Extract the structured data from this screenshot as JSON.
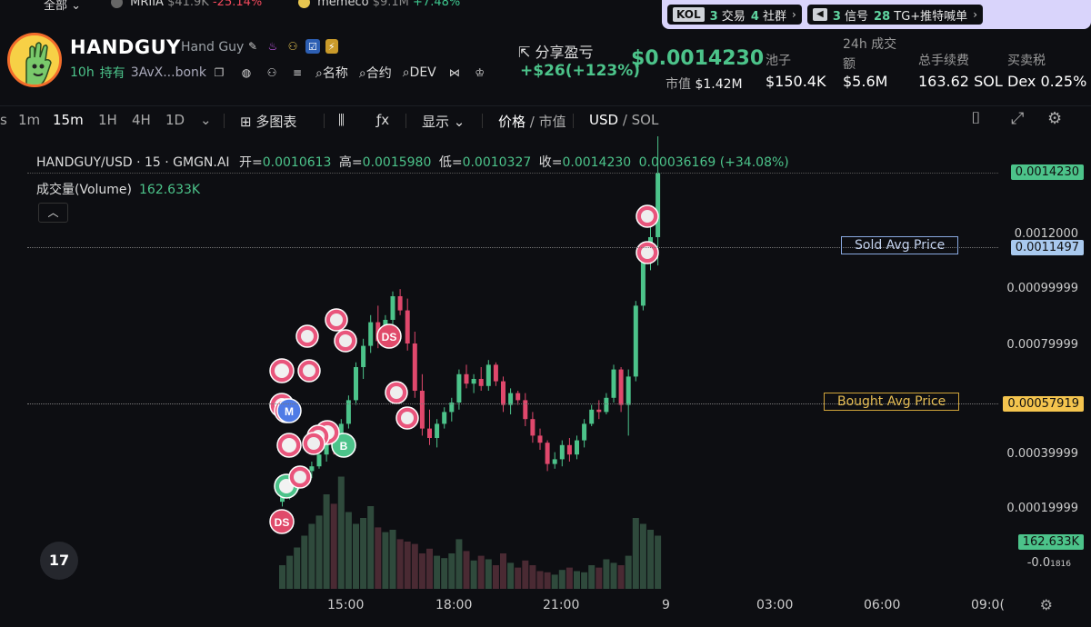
{
  "ticker": {
    "all_label": "全部",
    "items": [
      {
        "symbol": "MRIIA",
        "value": "$41.9K",
        "change": "-25.14%"
      },
      {
        "symbol": "memeco",
        "value": "$9.1M",
        "change": "+7.48%"
      }
    ]
  },
  "kol_panel": {
    "kol_badge": "KOL",
    "kol_trades_num": "3",
    "kol_trades_label": "交易",
    "kol_social_num": "4",
    "kol_social_label": "社群",
    "signal_num": "3",
    "signal_label": "信号",
    "tg_num": "28",
    "tg_label": "TG+推特喊单"
  },
  "token": {
    "name": "HANDGUY",
    "full_name": "Hand Guy",
    "age": "10h",
    "hold_label": "持有",
    "address": "3AvX...bonk",
    "links": {
      "name": "名称",
      "contract": "合约",
      "dev": "DEV"
    },
    "share_label": "分享盈亏",
    "pnl": "+$26(+123%)",
    "price": "$0.0014230",
    "mcap_label": "市值",
    "mcap": "$1.42M",
    "stats": [
      {
        "label": "池子",
        "value": "$150.4K"
      },
      {
        "label": "24h 成交额",
        "value": "$5.6M"
      },
      {
        "label": "总手续费",
        "value": "163.62 SOL"
      },
      {
        "label": "买卖税",
        "value": "Dex 0.25%"
      }
    ]
  },
  "toolbar": {
    "intervals": [
      "s",
      "1m",
      "15m",
      "1H",
      "4H",
      "1D"
    ],
    "active_interval": "15m",
    "multi_chart": "多图表",
    "display": "显示",
    "price_label": "价格",
    "mcap_label": "市值",
    "usd_label": "USD",
    "sol_label": "SOL"
  },
  "chart": {
    "pair": "HANDGUY/USD · 15 · GMGN.AI",
    "open_label": "开=",
    "open": "0.0010613",
    "high_label": "高=",
    "high": "0.0015980",
    "low_label": "低=",
    "low": "0.0010327",
    "close_label": "收=",
    "close": "0.0014230",
    "change": "0.00036169 (+34.08%)",
    "volume_label": "成交量(Volume)",
    "volume": "162.633K",
    "collapse_icon": "chevron-up-icon",
    "y_labels": [
      "0.0012000",
      "0.00099999",
      "0.00079999",
      "0.00039999",
      "0.00019999",
      "-0.0"
    ],
    "neg_small": "1816",
    "price_tag": "0.0014230",
    "sold_tag": "0.0011497",
    "bought_tag": "0.00057919",
    "volume_tag": "162.633K",
    "sold_label": "Sold Avg Price",
    "bought_label": "Bought Avg Price",
    "x_labels": [
      "15:00",
      "18:00",
      "21:00",
      "9",
      "03:00",
      "06:00",
      "09:0("
    ],
    "tv_logo": "17",
    "up_color": "#4cc38a",
    "down_color": "#e0486c"
  },
  "chart_data": {
    "type": "bar",
    "title": "",
    "xlabel": "",
    "ylabel": "",
    "ylim": [
      0,
      0.0016
    ],
    "candles": [
      {
        "o": 3e-05,
        "h": 6e-05,
        "l": 1e-05,
        "c": 5e-05
      },
      {
        "o": 5e-05,
        "h": 9e-05,
        "l": 4e-05,
        "c": 8e-05
      },
      {
        "o": 8e-05,
        "h": 0.00012,
        "l": 7e-05,
        "c": 0.00011
      },
      {
        "o": 0.00011,
        "h": 0.00018,
        "l": 0.0001,
        "c": 0.00016
      },
      {
        "o": 0.00016,
        "h": 0.0002,
        "l": 0.00013,
        "c": 0.00018
      },
      {
        "o": 0.00018,
        "h": 0.00025,
        "l": 0.00017,
        "c": 0.00023
      },
      {
        "o": 0.00023,
        "h": 0.0003,
        "l": 0.0002,
        "c": 0.00028
      },
      {
        "o": 0.00028,
        "h": 0.00033,
        "l": 0.00023,
        "c": 0.00026
      },
      {
        "o": 0.00026,
        "h": 0.00038,
        "l": 0.00024,
        "c": 0.00036
      },
      {
        "o": 0.00036,
        "h": 0.00048,
        "l": 0.00034,
        "c": 0.00046
      },
      {
        "o": 0.00046,
        "h": 0.00062,
        "l": 0.00044,
        "c": 0.0006
      },
      {
        "o": 0.0006,
        "h": 0.00072,
        "l": 0.00055,
        "c": 0.00069
      },
      {
        "o": 0.00069,
        "h": 0.00082,
        "l": 0.00066,
        "c": 0.00079
      },
      {
        "o": 0.00079,
        "h": 0.00086,
        "l": 0.00068,
        "c": 0.00071
      },
      {
        "o": 0.00071,
        "h": 0.00082,
        "l": 0.00069,
        "c": 0.0008
      },
      {
        "o": 0.0008,
        "h": 0.00092,
        "l": 0.00077,
        "c": 0.0009
      },
      {
        "o": 0.0009,
        "h": 0.00093,
        "l": 0.00082,
        "c": 0.00084
      },
      {
        "o": 0.00084,
        "h": 0.00089,
        "l": 0.00067,
        "c": 0.0007
      },
      {
        "o": 0.0007,
        "h": 0.00075,
        "l": 0.00047,
        "c": 0.0005
      },
      {
        "o": 0.0005,
        "h": 0.00057,
        "l": 0.00031,
        "c": 0.00034
      },
      {
        "o": 0.00034,
        "h": 0.00042,
        "l": 0.00027,
        "c": 0.0003
      },
      {
        "o": 0.0003,
        "h": 0.00038,
        "l": 0.00026,
        "c": 0.00036
      },
      {
        "o": 0.00036,
        "h": 0.00043,
        "l": 0.00034,
        "c": 0.00041
      },
      {
        "o": 0.00041,
        "h": 0.00047,
        "l": 0.00037,
        "c": 0.00045
      },
      {
        "o": 0.00045,
        "h": 0.00059,
        "l": 0.00042,
        "c": 0.00057
      },
      {
        "o": 0.00057,
        "h": 0.00061,
        "l": 0.00051,
        "c": 0.00053
      },
      {
        "o": 0.00053,
        "h": 0.00057,
        "l": 0.00049,
        "c": 0.00055
      },
      {
        "o": 0.00055,
        "h": 0.0006,
        "l": 0.0005,
        "c": 0.00052
      },
      {
        "o": 0.00052,
        "h": 0.00063,
        "l": 0.0005,
        "c": 0.00061
      },
      {
        "o": 0.00061,
        "h": 0.00062,
        "l": 0.00052,
        "c": 0.00054
      },
      {
        "o": 0.00054,
        "h": 0.00056,
        "l": 0.00041,
        "c": 0.00044
      },
      {
        "o": 0.00044,
        "h": 0.00051,
        "l": 0.0004,
        "c": 0.00049
      },
      {
        "o": 0.00049,
        "h": 0.0005,
        "l": 0.00044,
        "c": 0.00046
      },
      {
        "o": 0.00046,
        "h": 0.00049,
        "l": 0.00035,
        "c": 0.00038
      },
      {
        "o": 0.00038,
        "h": 0.00041,
        "l": 0.00028,
        "c": 0.00031
      },
      {
        "o": 0.00031,
        "h": 0.00034,
        "l": 0.00025,
        "c": 0.00028
      },
      {
        "o": 0.00028,
        "h": 0.00029,
        "l": 0.00016,
        "c": 0.00019
      },
      {
        "o": 0.00019,
        "h": 0.00024,
        "l": 0.00017,
        "c": 0.00021
      },
      {
        "o": 0.00021,
        "h": 0.00029,
        "l": 0.00018,
        "c": 0.00027
      },
      {
        "o": 0.00027,
        "h": 0.0003,
        "l": 0.0002,
        "c": 0.00023
      },
      {
        "o": 0.00023,
        "h": 0.00031,
        "l": 0.00021,
        "c": 0.00029
      },
      {
        "o": 0.00029,
        "h": 0.00038,
        "l": 0.00026,
        "c": 0.00036
      },
      {
        "o": 0.00036,
        "h": 0.00044,
        "l": 0.00035,
        "c": 0.00042
      },
      {
        "o": 0.00042,
        "h": 0.00046,
        "l": 0.00038,
        "c": 0.00041
      },
      {
        "o": 0.00041,
        "h": 0.00049,
        "l": 0.0004,
        "c": 0.00047
      },
      {
        "o": 0.00047,
        "h": 0.00061,
        "l": 0.00045,
        "c": 0.00059
      },
      {
        "o": 0.00059,
        "h": 0.0006,
        "l": 0.00041,
        "c": 0.00044
      },
      {
        "o": 0.00044,
        "h": 0.00059,
        "l": 0.00031,
        "c": 0.00056
      },
      {
        "o": 0.00056,
        "h": 0.00088,
        "l": 0.00054,
        "c": 0.00086
      },
      {
        "o": 0.00086,
        "h": 0.00108,
        "l": 0.00084,
        "c": 0.00105
      },
      {
        "o": 0.00105,
        "h": 0.0012,
        "l": 0.00101,
        "c": 0.00115
      },
      {
        "o": 0.00115,
        "h": 0.0016,
        "l": 0.00103,
        "c": 0.001423
      }
    ],
    "volumes": [
      0.2,
      0.28,
      0.35,
      0.45,
      0.55,
      0.62,
      0.8,
      0.72,
      0.95,
      0.65,
      0.55,
      0.6,
      0.7,
      0.52,
      0.48,
      0.5,
      0.42,
      0.4,
      0.38,
      0.3,
      0.34,
      0.28,
      0.26,
      0.3,
      0.42,
      0.32,
      0.24,
      0.28,
      0.25,
      0.2,
      0.3,
      0.22,
      0.18,
      0.24,
      0.2,
      0.15,
      0.14,
      0.12,
      0.16,
      0.18,
      0.15,
      0.14,
      0.2,
      0.18,
      0.25,
      0.22,
      0.2,
      0.28,
      0.6,
      0.55,
      0.5,
      0.45
    ]
  },
  "markers": [
    {
      "kind": "avatar",
      "color": "#e9557c"
    },
    {
      "kind": "avatar",
      "color": "#e9557c"
    },
    {
      "kind": "avatar",
      "color": "#e9557c"
    },
    {
      "kind": "avatar",
      "color": "#e9557c"
    },
    {
      "kind": "letter",
      "text": "M",
      "color": "#4f7be6"
    },
    {
      "kind": "letter",
      "text": "DS",
      "color": "#e04a6a"
    },
    {
      "kind": "letter",
      "text": "DS",
      "color": "#e04a6a"
    },
    {
      "kind": "letter",
      "text": "B",
      "color": "#4cc38a"
    },
    {
      "kind": "avatar",
      "color": "#e9557c"
    },
    {
      "kind": "avatar",
      "color": "#4cc38a"
    }
  ]
}
